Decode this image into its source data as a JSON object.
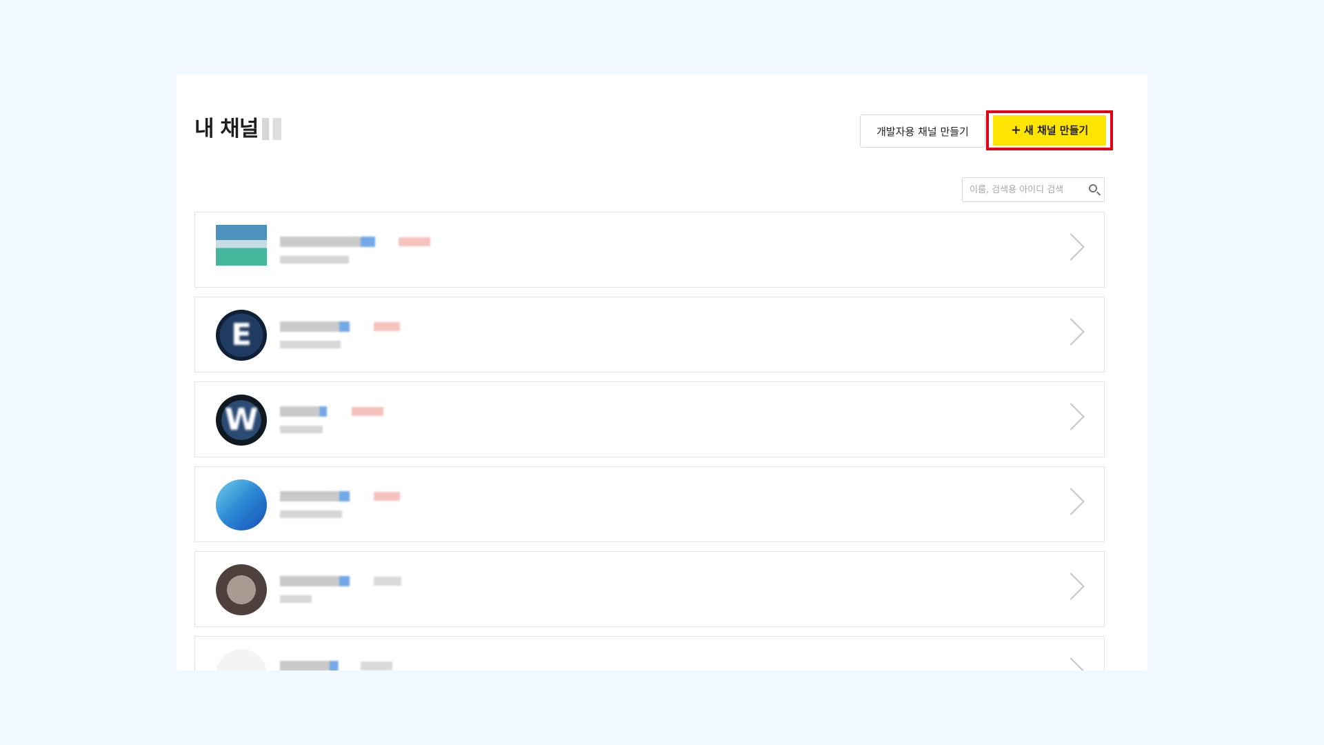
{
  "header": {
    "title": "내 채널",
    "dev_channel_button": "개발자용 채널 만들기",
    "new_channel_button": "새 채널 만들기",
    "new_channel_icon": "+",
    "highlight_color": "#e40012",
    "accent_color": "#fee500"
  },
  "search": {
    "placeholder": "이름, 검색용 아이디 검색",
    "icon": "search-icon"
  },
  "channels": [
    {
      "avatar_letter": ""
    },
    {
      "avatar_letter": "E"
    },
    {
      "avatar_letter": "W"
    },
    {
      "avatar_letter": ""
    },
    {
      "avatar_letter": ""
    },
    {
      "avatar_letter": ""
    }
  ]
}
